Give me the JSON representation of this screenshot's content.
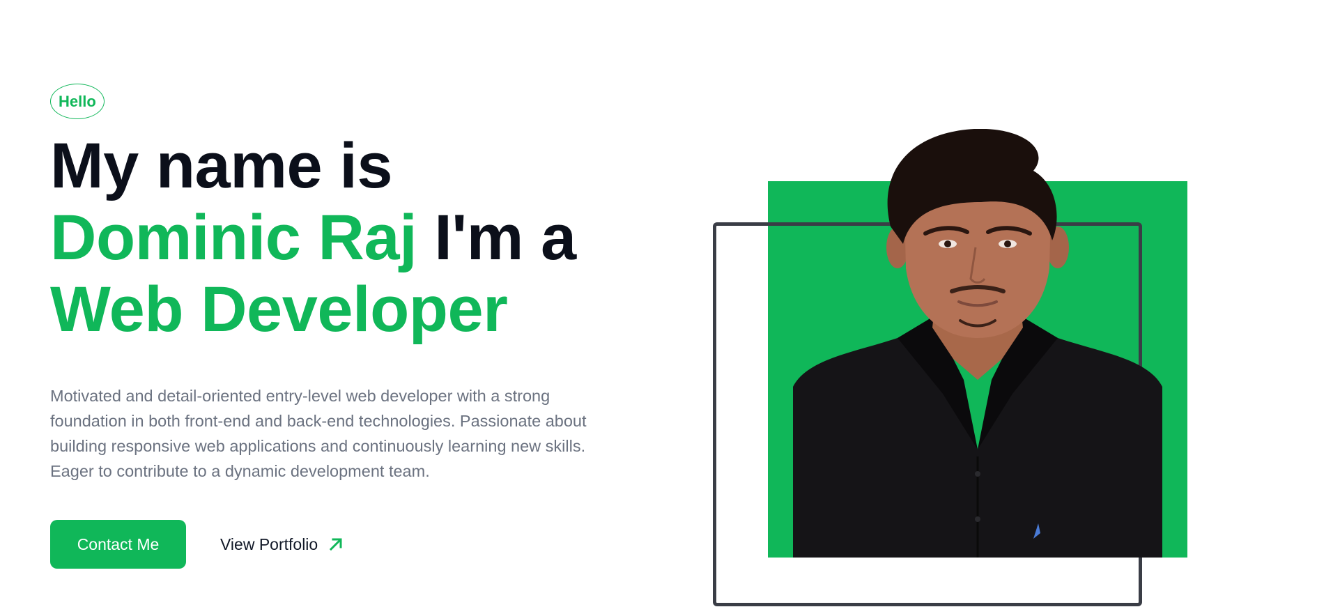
{
  "hero": {
    "badge": "Hello",
    "headline": {
      "line1": "My name is",
      "name": "Dominic Raj",
      "connector": " I'm a",
      "role": "Web Developer"
    },
    "bio": "Motivated and detail-oriented entry-level web developer with a strong foundation in both front-end and back-end technologies. Passionate about building responsive web applications and continuously learning new skills. Eager to contribute to a dynamic development team.",
    "primary_button": "Contact Me",
    "secondary_link": "View Portfolio",
    "secondary_link_icon": "arrow-up-right-icon"
  },
  "photo": {
    "icon": "portrait-photo",
    "backdrop_color": "#10b759",
    "frame_color": "#3a3d46"
  },
  "colors": {
    "accent": "#10b759",
    "heading": "#0b0f1a",
    "body_text": "#6b7280"
  }
}
